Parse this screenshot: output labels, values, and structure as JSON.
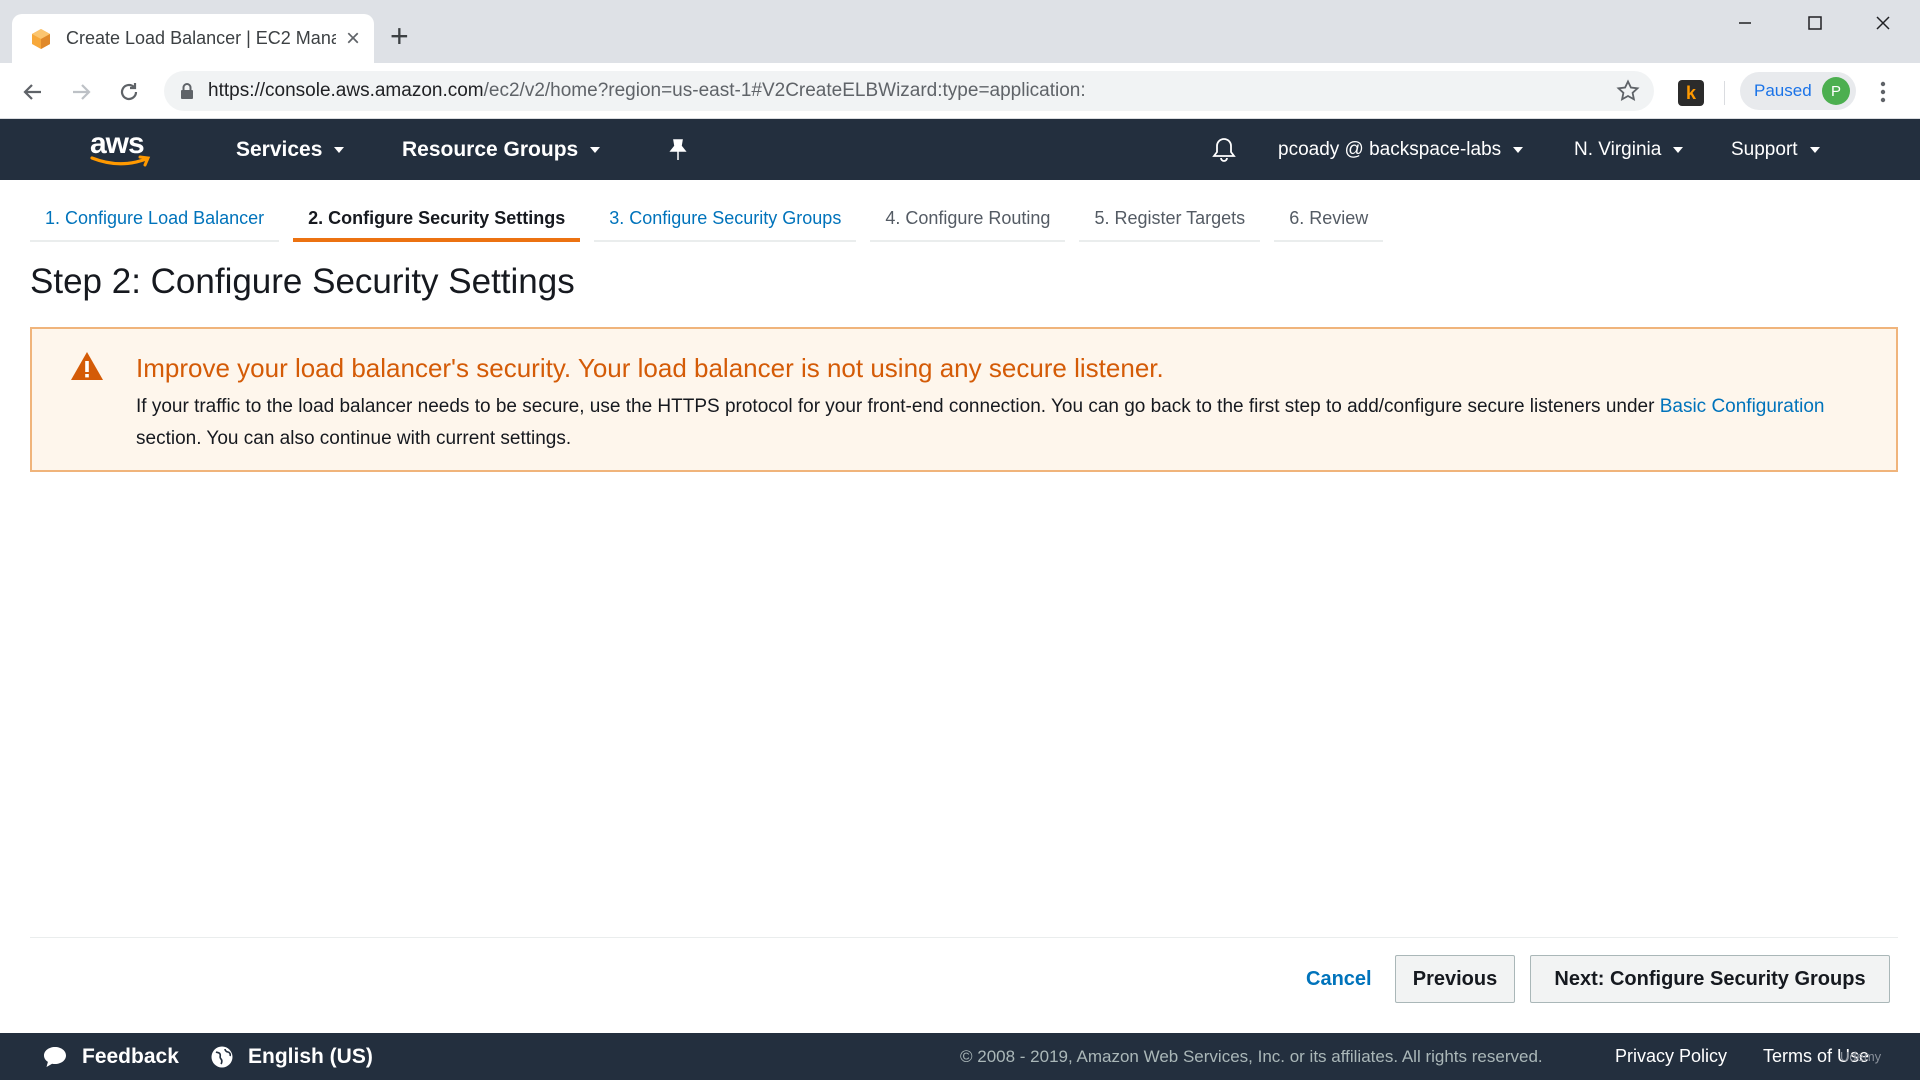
{
  "browser": {
    "tab_title": "Create Load Balancer | EC2 Mana",
    "url_host": "https://console.aws.amazon.com",
    "url_path": "/ec2/v2/home?region=us-east-1#V2CreateELBWizard:type=application:",
    "extension_letter": "k",
    "profile_status": "Paused",
    "profile_initial": "P"
  },
  "nav": {
    "logo": "aws",
    "services": "Services",
    "resource_groups": "Resource Groups",
    "user": "pcoady @ backspace-labs",
    "region": "N. Virginia",
    "support": "Support"
  },
  "wizard": {
    "steps": [
      {
        "label": "1. Configure Load Balancer",
        "state": "complete"
      },
      {
        "label": "2. Configure Security Settings",
        "state": "active"
      },
      {
        "label": "3. Configure Security Groups",
        "state": "next"
      },
      {
        "label": "4. Configure Routing",
        "state": "future"
      },
      {
        "label": "5. Register Targets",
        "state": "future"
      },
      {
        "label": "6. Review",
        "state": "future"
      }
    ],
    "title": "Step 2: Configure Security Settings"
  },
  "alert": {
    "heading": "Improve your load balancer's security. Your load balancer is not using any secure listener.",
    "body_before": "If your traffic to the load balancer needs to be secure, use the HTTPS protocol for your front-end connection. You can go back to the first step to add/configure secure listeners under ",
    "link": "Basic Configuration",
    "body_after": " section. You can also continue with current settings."
  },
  "actions": {
    "cancel": "Cancel",
    "previous": "Previous",
    "next": "Next: Configure Security Groups"
  },
  "footer": {
    "feedback": "Feedback",
    "language": "English (US)",
    "copyright": "© 2008 - 2019, Amazon Web Services, Inc. or its affiliates. All rights reserved.",
    "privacy": "Privacy Policy",
    "terms": "Terms of Use",
    "watermark": "Udemy"
  },
  "colors": {
    "nav_bg": "#232f3e",
    "accent_orange": "#ec7211",
    "link_blue": "#0073bb",
    "warning_text": "#d45b07",
    "warning_bg": "#fef6ec"
  }
}
